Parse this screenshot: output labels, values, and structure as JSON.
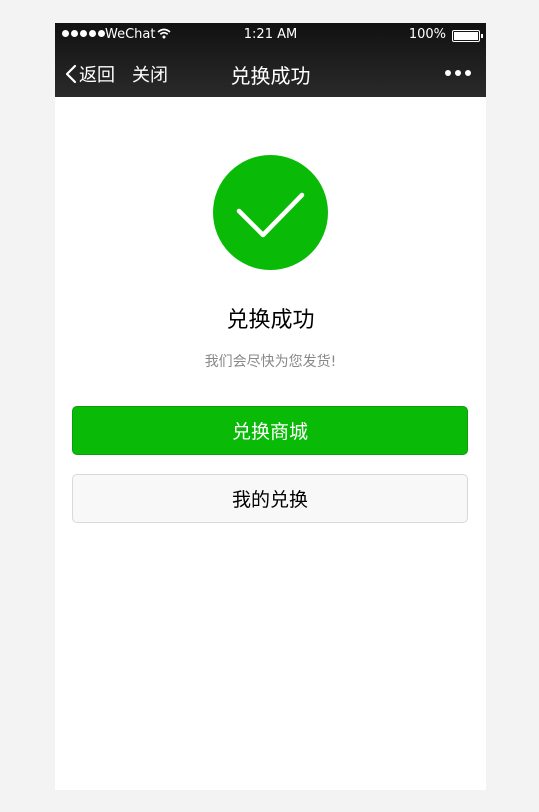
{
  "status_bar": {
    "carrier": "WeChat",
    "time": "1:21 AM",
    "battery": "100%",
    "battery_level": 1.0
  },
  "nav": {
    "back_label": "返回",
    "close_label": "关闭",
    "title": "兑换成功"
  },
  "result": {
    "title": "兑换成功",
    "message": "我们会尽快为您发货!"
  },
  "buttons": {
    "primary_label": "兑换商城",
    "secondary_label": "我的兑换"
  },
  "colors": {
    "brand_green": "#09bb07",
    "nav_background": "#1b1b1b"
  },
  "icons": {
    "success": "checkmark-circle-icon",
    "back": "chevron-left-icon",
    "more": "more-dots-icon"
  }
}
